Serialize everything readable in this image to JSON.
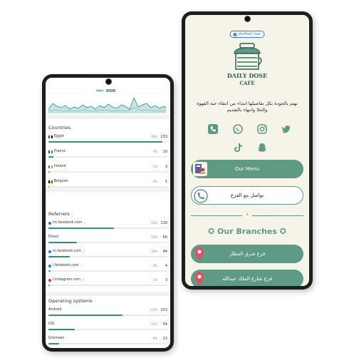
{
  "analytics": {
    "legend": [
      "Visits",
      "Clicks"
    ],
    "countries": {
      "title": "Countries",
      "rows": [
        {
          "label": "Egypt",
          "pct": "96%",
          "count": "233",
          "share": 0.96,
          "flag": [
            "#ce1126",
            "#ffffff",
            "#000000"
          ]
        },
        {
          "label": "France",
          "pct": "4%",
          "count": "10",
          "share": 0.04,
          "flag": [
            "#0055a4",
            "#ffffff",
            "#ef4135"
          ]
        },
        {
          "label": "Ireland",
          "pct": "1%",
          "count": "3",
          "share": 0.01,
          "flag": [
            "#169b62",
            "#ffffff",
            "#ff883e"
          ]
        },
        {
          "label": "Belgium",
          "pct": "0%",
          "count": "1",
          "share": 0.005,
          "flag": [
            "#000000",
            "#fdda24",
            "#ef3340"
          ]
        }
      ]
    },
    "referrers": {
      "title": "Referrers",
      "rows": [
        {
          "label": "lm.facebook.com",
          "pct": "55%",
          "count": "136",
          "share": 0.55,
          "icon": "facebook-icon",
          "color": "#1877f2"
        },
        {
          "label": "Direct",
          "pct": "24%",
          "count": "60",
          "share": 0.24,
          "icon": "",
          "color": ""
        },
        {
          "label": "m.facebook.com",
          "pct": "18%",
          "count": "44",
          "share": 0.18,
          "icon": "facebook-icon",
          "color": "#1877f2"
        },
        {
          "label": "l.facebook.com",
          "pct": "2%",
          "count": "4",
          "share": 0.02,
          "icon": "facebook-icon",
          "color": "#1877f2"
        },
        {
          "label": "l.instagram.com",
          "pct": "1%",
          "count": "3",
          "share": 0.01,
          "icon": "instagram-icon",
          "color": "#d6249f"
        }
      ]
    },
    "os": {
      "title": "Operating systems",
      "rows": [
        {
          "label": "Android",
          "pct": "62%",
          "count": "153",
          "share": 0.62
        },
        {
          "label": "iOS",
          "pct": "22%",
          "count": "54",
          "share": 0.22
        },
        {
          "label": "Unknown",
          "pct": "9%",
          "count": "23",
          "share": 0.09
        }
      ]
    }
  },
  "cafe": {
    "verified_label": "Verified User",
    "logo_line1": "DAILY DOSE",
    "logo_line2": "CAFE",
    "description": "نهتم بالجودة بكل تفاصيلها ابتداء من انتقاء حبة القهوة والحلا وانتهاء بالتقديم",
    "socials": [
      "phone-icon",
      "whatsapp-icon",
      "instagram-icon",
      "twitter-icon",
      "tiktok-icon",
      "snapchat-icon"
    ],
    "menu_label": "Our Menu",
    "contact_label": "تواصل مع الفرع",
    "branches_title": "✪ Our Branches ✪",
    "branches": [
      "فرع شرق المطار",
      "فرع شارع الملك عبدالله"
    ],
    "colors": {
      "primary": "#5f9a84",
      "background": "#f6f4e9",
      "verified": "#2f7fc1"
    }
  }
}
